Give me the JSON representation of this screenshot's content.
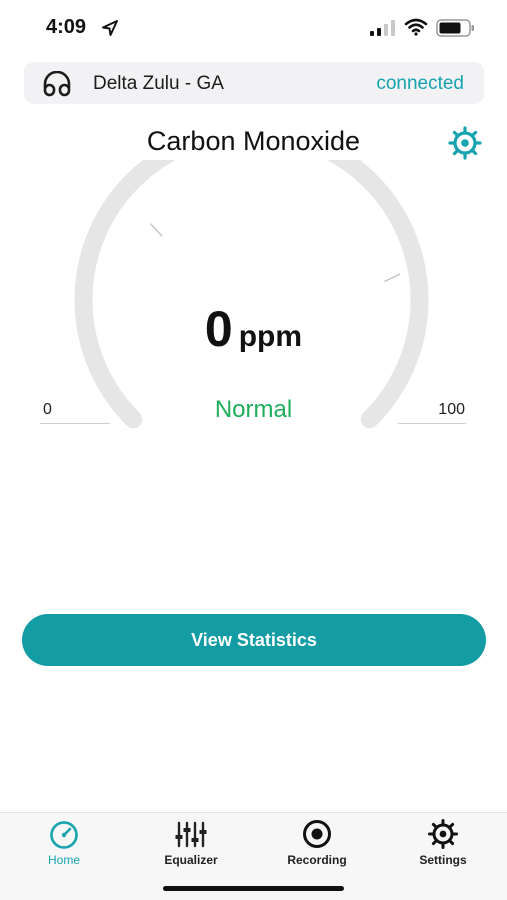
{
  "status_bar": {
    "time": "4:09",
    "icons": [
      "location-arrow-icon",
      "cellular-signal-icon",
      "wifi-icon",
      "battery-icon"
    ]
  },
  "device": {
    "icon": "headphones-icon",
    "name": "Delta Zulu - GA",
    "status": "connected"
  },
  "page": {
    "title": "Carbon Monoxide",
    "settings_icon": "gear-icon"
  },
  "gauge": {
    "value": "0",
    "unit": "ppm",
    "level": "Normal",
    "min_label": "0",
    "max_label": "100",
    "fill_fraction": 0
  },
  "actions": {
    "view_statistics": "View Statistics"
  },
  "tabs": [
    {
      "label": "Home",
      "icon": "speedometer-icon",
      "active": true
    },
    {
      "label": "Equalizer",
      "icon": "equalizer-sliders-icon",
      "active": false
    },
    {
      "label": "Recording",
      "icon": "record-icon",
      "active": false
    },
    {
      "label": "Settings",
      "icon": "gear-icon",
      "active": false
    }
  ],
  "colors": {
    "accent": "#17a4b0",
    "button": "#139ca3",
    "normal": "#1fae5c",
    "gauge_track": "#e6e6e6"
  }
}
